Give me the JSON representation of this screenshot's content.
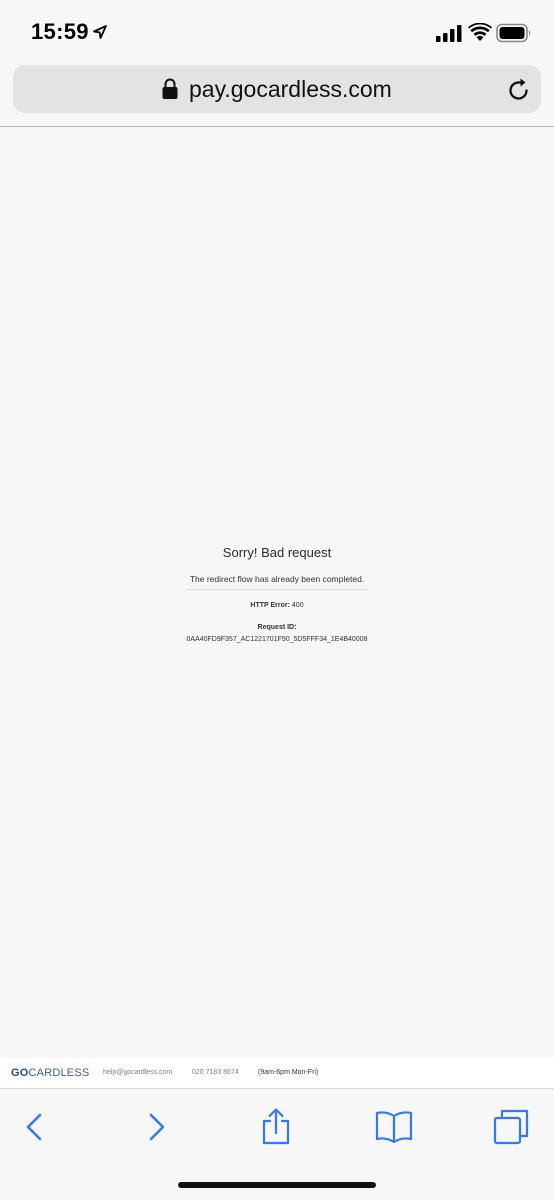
{
  "status_bar": {
    "time": "15:59",
    "icons": [
      "location-arrow-icon",
      "cellular-signal-icon",
      "wifi-icon",
      "battery-icon"
    ]
  },
  "address_bar": {
    "url": "pay.gocardless.com",
    "icons": [
      "lock-icon",
      "reload-icon"
    ]
  },
  "error": {
    "title": "Sorry! Bad request",
    "message": "The redirect flow has already been completed.",
    "http_label": "HTTP Error:",
    "http_code": "400",
    "request_label": "Request ID:",
    "request_id": "0AA40FD9F357_AC1221701F90_5D5FFF34_1E4B40008"
  },
  "footer": {
    "logo_bold": "GO",
    "logo_rest": "CARDLESS",
    "email": "help@gocardless.com",
    "phone": "020 7183 8674",
    "hours": "(9am-6pm Mon-Fri)"
  },
  "toolbar": {
    "icons": [
      "back-arrow-icon",
      "forward-arrow-icon",
      "share-icon",
      "bookmarks-icon",
      "tabs-icon"
    ]
  },
  "colors": {
    "accent": "#3478f6",
    "background": "#f6f6f6",
    "brand": "#1f4d7a"
  }
}
